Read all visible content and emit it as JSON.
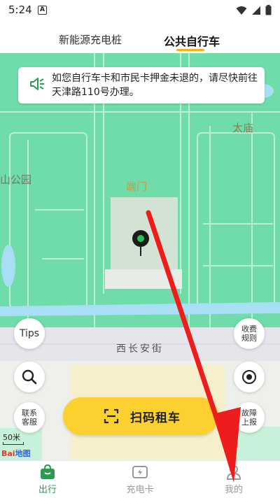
{
  "status_bar": {
    "time": "5:24",
    "notif_icon": "A"
  },
  "tabs": [
    {
      "label": "新能源充电桩",
      "active": false
    },
    {
      "label": "公共自行车",
      "active": true
    }
  ],
  "notice": {
    "icon": "speaker-icon",
    "text": "如您自行车卡和市民卡押金未退的，请尽快前往天津路110号办理。"
  },
  "map": {
    "labels": {
      "taimiao": "太庙",
      "park": "山公园",
      "duanmen": "端门",
      "street": "西长安街"
    },
    "scale": "50米",
    "provider_logo": {
      "red": "Bai",
      "blue": "地图"
    }
  },
  "buttons": {
    "tips": "Tips",
    "service_line1": "联系",
    "service_line2": "客服",
    "fee_line1": "收费",
    "fee_line2": "规则",
    "report_line1": "故障",
    "report_line2": "上报",
    "scan": "扫码租车"
  },
  "bottom_nav": [
    {
      "label": "出行",
      "icon": "bag-icon",
      "active": true
    },
    {
      "label": "充电卡",
      "icon": "charge-card-icon",
      "active": false
    },
    {
      "label": "我的",
      "icon": "user-icon",
      "active": false
    }
  ],
  "colors": {
    "accent_green": "#2e9b54",
    "scan_button": "#fbd02f",
    "tab_underline": "#f6b01e",
    "map_green": "#6fdca9",
    "arrow_red": "#ee1c1c"
  }
}
